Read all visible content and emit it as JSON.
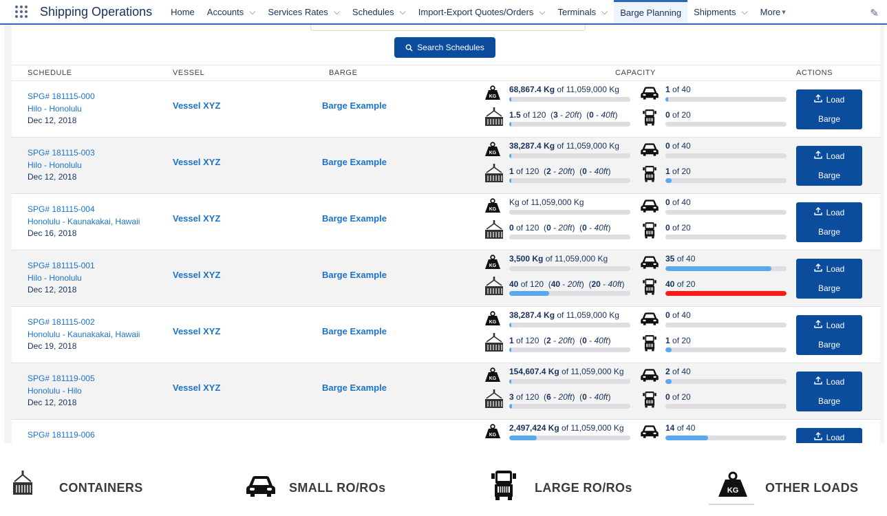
{
  "nav": {
    "app_title": "Shipping Operations",
    "items": [
      {
        "label": "Home",
        "has_menu": false
      },
      {
        "label": "Accounts",
        "has_menu": true
      },
      {
        "label": "Services Rates",
        "has_menu": true
      },
      {
        "label": "Schedules",
        "has_menu": true
      },
      {
        "label": "Import-Export Quotes/Orders",
        "has_menu": true
      },
      {
        "label": "Terminals",
        "has_menu": true
      },
      {
        "label": "Barge Planning",
        "has_menu": false,
        "active": true
      },
      {
        "label": "Shipments",
        "has_menu": true
      },
      {
        "label": "More",
        "has_menu": true
      }
    ]
  },
  "search_button": "Search Schedules",
  "table": {
    "headers": {
      "schedule": "SCHEDULE",
      "vessel": "VESSEL",
      "barge": "BARGE",
      "capacity": "CAPACITY",
      "actions": "ACTIONS"
    },
    "rows": [
      {
        "spg": "SPG# 181115-000",
        "route": "Hilo - Honolulu",
        "date": "Dec 12, 2018",
        "vessel": "Vessel XYZ",
        "barge": "Barge Example",
        "weight_bold": "68,867.4 Kg",
        "weight_rest": " of 11,059,000 Kg",
        "weight_pct": 1,
        "cont_bold": "1.5",
        "cont_rest": " of 120",
        "cont_20": "3",
        "cont_40": "0",
        "cont_pct": 1,
        "small_bold": "1",
        "small_rest": " of 40",
        "small_pct": 2.5,
        "large_bold": "0",
        "large_rest": " of 20",
        "large_pct": 0
      },
      {
        "spg": "SPG# 181115-003",
        "route": "Hilo - Honolulu",
        "date": "Dec 12, 2018",
        "vessel": "Vessel XYZ",
        "barge": "Barge Example",
        "weight_bold": "38,287.4 Kg",
        "weight_rest": " of 11,059,000 Kg",
        "weight_pct": 0.5,
        "cont_bold": "1",
        "cont_rest": " of 120",
        "cont_20": "2",
        "cont_40": "0",
        "cont_pct": 1,
        "small_bold": "0",
        "small_rest": " of 40",
        "small_pct": 0,
        "large_bold": "1",
        "large_rest": " of 20",
        "large_pct": 5
      },
      {
        "spg": "SPG# 181115-004",
        "route": "Honolulu - Kaunakakai, Hawaii",
        "date": "Dec 16, 2018",
        "vessel": "Vessel XYZ",
        "barge": "Barge Example",
        "weight_bold": "",
        "weight_rest": "Kg of 11,059,000 Kg",
        "weight_pct": 0,
        "cont_bold": "0",
        "cont_rest": " of 120",
        "cont_20": "0",
        "cont_40": "0",
        "cont_pct": 0,
        "small_bold": "0",
        "small_rest": " of 40",
        "small_pct": 0,
        "large_bold": "0",
        "large_rest": " of 20",
        "large_pct": 0
      },
      {
        "spg": "SPG# 181115-001",
        "route": "Hilo - Honolulu",
        "date": "Dec 12, 2018",
        "vessel": "Vessel XYZ",
        "barge": "Barge Example",
        "weight_bold": "3,500 Kg",
        "weight_rest": " of 11,059,000 Kg",
        "weight_pct": 0,
        "cont_bold": "40",
        "cont_rest": " of 120",
        "cont_20": "40",
        "cont_40": "20",
        "cont_pct": 33,
        "small_bold": "35",
        "small_rest": " of 40",
        "small_pct": 87.5,
        "large_bold": "40",
        "large_rest": " of 20",
        "large_pct": 100,
        "large_over": true
      },
      {
        "spg": "SPG# 181115-002",
        "route": "Honolulu - Kaunakakai, Hawaii",
        "date": "Dec 19, 2018",
        "vessel": "Vessel XYZ",
        "barge": "Barge Example",
        "weight_bold": "38,287.4 Kg",
        "weight_rest": " of 11,059,000 Kg",
        "weight_pct": 0.5,
        "cont_bold": "1",
        "cont_rest": " of 120",
        "cont_20": "2",
        "cont_40": "0",
        "cont_pct": 1,
        "small_bold": "0",
        "small_rest": " of 40",
        "small_pct": 0,
        "large_bold": "1",
        "large_rest": " of 20",
        "large_pct": 5
      },
      {
        "spg": "SPG# 181119-005",
        "route": "Honolulu - Hilo",
        "date": "Dec 12, 2018",
        "vessel": "Vessel XYZ",
        "barge": "Barge Example",
        "weight_bold": "154,607.4 Kg",
        "weight_rest": " of 11,059,000 Kg",
        "weight_pct": 1.4,
        "cont_bold": "3",
        "cont_rest": " of 120",
        "cont_20": "6",
        "cont_40": "0",
        "cont_pct": 2.5,
        "small_bold": "2",
        "small_rest": " of 40",
        "small_pct": 5,
        "large_bold": "0",
        "large_rest": " of 20",
        "large_pct": 0
      },
      {
        "spg": "SPG# 181119-006",
        "route": "",
        "date": "",
        "vessel": "",
        "barge": "",
        "weight_bold": "2,497,424 Kg",
        "weight_rest": " of 11,059,000 Kg",
        "weight_pct": 22.6,
        "cont_bold": "",
        "cont_rest": "",
        "cont_20": "",
        "cont_40": "",
        "cont_pct": 0,
        "small_bold": "14",
        "small_rest": " of 40",
        "small_pct": 35,
        "large_bold": "",
        "large_rest": "",
        "large_pct": 0
      }
    ],
    "load_label_1": "Load",
    "load_label_2": "Barge"
  },
  "legend": {
    "containers": "CONTAINERS",
    "small_roro": "SMALL RO/ROs",
    "large_roro": "LARGE RO/ROs",
    "other_loads": "OTHER LOADS"
  },
  "colors": {
    "brand_blue": "#0b4d9c",
    "link_blue": "#1a73c9",
    "bar_fill": "#5aa9ef",
    "bar_over": "#ff1a1a"
  }
}
